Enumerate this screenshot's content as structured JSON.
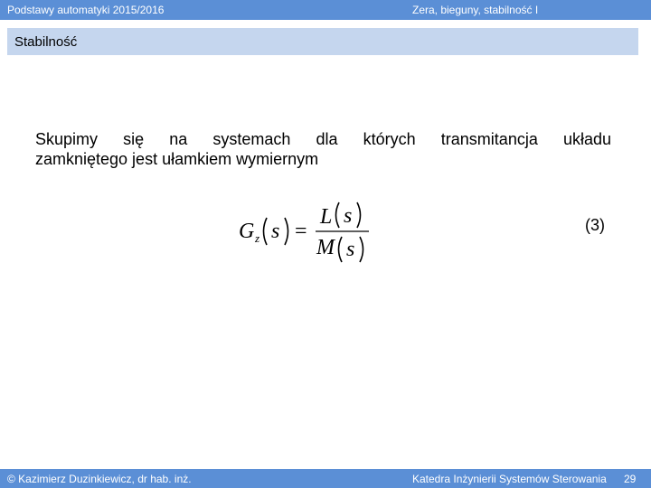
{
  "header": {
    "course": "Podstawy automatyki 2015/2016",
    "topic": "Zera, bieguny, stabilność I"
  },
  "section": {
    "title": "Stabilność"
  },
  "body": {
    "line1": "Skupimy się na systemach dla których transmitancja układu",
    "line2": "zamkniętego jest ułamkiem wymiernym"
  },
  "formula": {
    "G": "G",
    "subscript": "z",
    "s": "s",
    "equals": "=",
    "numerator_fn": "L",
    "denominator_fn": "M"
  },
  "equation_number": "(3)",
  "footer": {
    "author": "© Kazimierz Duzinkiewicz, dr hab. inż.",
    "department": "Katedra Inżynierii Systemów Sterowania",
    "page_number": "29"
  },
  "colors": {
    "bar": "#5b8fd6",
    "section_band": "#c5d6ee"
  }
}
